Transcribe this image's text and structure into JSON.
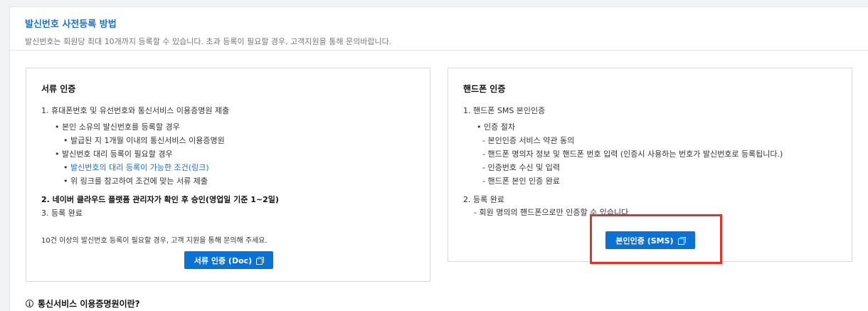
{
  "header": {
    "title": "발신번호 사전등록 방법",
    "subtitle": "발신번호는 회원당 최대 10개까지 등록할 수 있습니다. 초과 등록이 필요할 경우, 고객지원을 통해 문의바랍니다."
  },
  "doc": {
    "title": "서류 인증",
    "step1": "1. 휴대폰번호 및 유선번호와 통신서비스 이용증명원 제출",
    "b1": "• 본인 소유의 발신번호를 등록할 경우",
    "b1a": "• 발급된 지 1개월 이내의 통신서비스 이용증명원",
    "b2": "• 발신번호 대리 등록이 필요할 경우",
    "b2a_bullet": "•",
    "b2a_link": "발신번호의 대리 등록이 가능한 조건(링크)",
    "b2b": "• 위 링크를 참고하여 조건에 맞는 서류 제출",
    "step2": "2. 네이버 클라우드 플랫폼 관리자가 확인 후 승인(영업일 기준 1~2일)",
    "step3": "3. 등록 완료",
    "note": "10건 이상의 발신번호 등록이 필요할 경우, 고객 지원을 통해 문의해 주세요.",
    "button": "서류 인증 (Doc)",
    "button_icon": "copy-icon"
  },
  "phone": {
    "title": "핸드폰 인증",
    "step1": "1. 핸드폰 SMS 본인인증",
    "b1": "• 인증 절차",
    "d1": "- 본인인증 서비스 약관 동의",
    "d2": "- 핸드폰 명의자 정보 및 핸드폰 번호 입력 (인증시 사용하는 번호가 발신번호로 등록됩니다.)",
    "d3": "- 인증번호 수신 및 입력",
    "d4": "- 핸드폰 본인 인증 완료",
    "step2": "2. 등록 완료",
    "step2note": "- 회원 명의의 핸드폰으로만 인증할 수 있습니다",
    "button": "본인인증 (SMS)",
    "button_icon": "copy-icon"
  },
  "faq": {
    "icon": "info-icon",
    "title": "통신서비스 이용증명원이란?"
  },
  "colors": {
    "accent": "#1a73c8",
    "button": "#0b72d4",
    "highlight": "#e8302a"
  }
}
